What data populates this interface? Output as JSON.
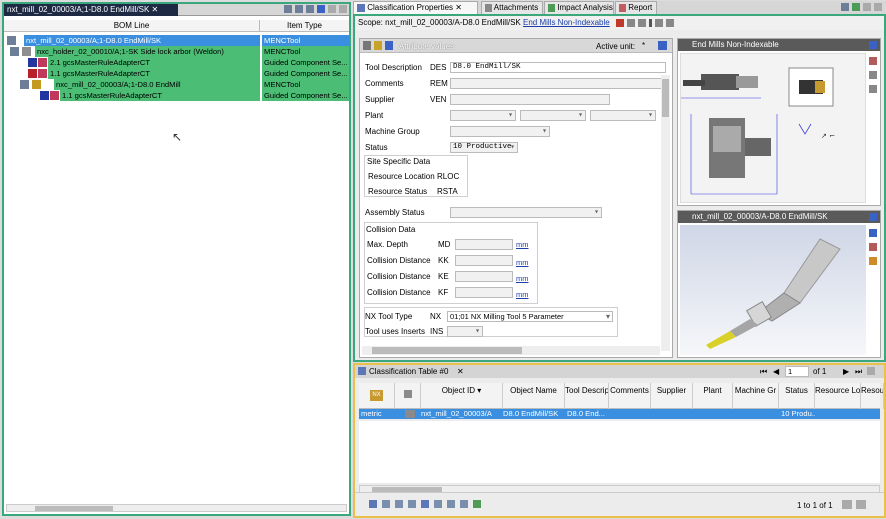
{
  "bom": {
    "tab_title": "nxt_mill_02_00003/A;1-D8.0 EndMill/SK",
    "col_bom_line": "BOM Line",
    "col_item_type": "Item Type",
    "rows": [
      {
        "label": "nxt_mill_02_00003/A;1-D8.0 EndMill/SK",
        "type": "MENCTool"
      },
      {
        "label": "nxc_holder_02_00010/A;1-SK Side lock arbor (Weldon)",
        "type": "MENCTool"
      },
      {
        "label": "2.1 gcsMasterRuleAdapterCT",
        "type": "Guided Component Se..."
      },
      {
        "label": "1.1 gcsMasterRuleAdapterCT",
        "type": "Guided Component Se..."
      },
      {
        "label": "nxc_mill_02_00003/A;1-D8.0 EndMill",
        "type": "MENCTool"
      },
      {
        "label": "1.1 gcsMasterRuleAdapterCT",
        "type": "Guided Component Se..."
      }
    ]
  },
  "right_tabs": {
    "classification": "Classification Properties",
    "attachments": "Attachments",
    "impact": "Impact Analysis",
    "report": "Report"
  },
  "scope": {
    "prefix": "Scope: nxt_mill_02_00003/A-D8.0 EndMill/SK",
    "link": "End Mills Non-Indexable"
  },
  "attr": {
    "header": "Attribute values",
    "active_unit_label": "Active unit:",
    "active_unit_value": "*",
    "tool_desc_label": "Tool Description",
    "tool_desc_code": "DES",
    "tool_desc_value": "D8.0 EndMill/SK",
    "comments_label": "Comments",
    "comments_code": "REM",
    "supplier_label": "Supplier",
    "supplier_code": "VEN",
    "plant_label": "Plant",
    "machine_group_label": "Machine Group",
    "status_label": "Status",
    "status_value": "10 Productive",
    "site_specific": "Site Specific Data",
    "res_loc_label": "Resource Location",
    "res_loc_code": "RLOC",
    "res_status_label": "Resource Status",
    "res_status_code": "RSTA",
    "assembly_status_label": "Assembly Status",
    "collision_data": "Collision Data",
    "max_depth_label": "Max. Depth",
    "max_depth_code": "MD",
    "cd_kk_label": "Collision Distance",
    "cd_kk_code": "KK",
    "cd_ke_label": "Collision Distance",
    "cd_ke_code": "KE",
    "cd_kf_label": "Collision Distance",
    "cd_kf_code": "KF",
    "mm": "mm",
    "nx_tool_type_label": "NX Tool Type",
    "nx_tool_type_code": "NX",
    "nx_tool_type_value": "01;01 NX Milling Tool 5 Parameter",
    "inserts_label": "Tool uses Inserts",
    "inserts_code": "INS"
  },
  "panel_top": {
    "title": "End Mills Non-Indexable"
  },
  "panel_bottom": {
    "title": "nxt_mill_02_00003/A-D8.0 EndMill/SK"
  },
  "ctable": {
    "title": "Classification Table #0",
    "page_value": "1",
    "page_of": "of 1",
    "nx_icon": "NX",
    "columns": [
      "Object ID",
      "Object Name",
      "Tool Description",
      "Comments",
      "Supplier",
      "Plant",
      "Machine Gr",
      "Status",
      "Resource Lo",
      "Resou"
    ],
    "row": [
      "metric",
      "nxt_mill_02_00003/A",
      "D8.0 EndMill/SK",
      "D8.0 End...",
      "",
      "",
      "",
      "",
      "10 Produ...",
      "",
      ""
    ],
    "footer_count": "1 to 1 of 1"
  },
  "colors": {
    "accent_green": "#3aa87c",
    "selection_blue": "#3a8fe0",
    "bom_green": "#4bbd74",
    "table_border": "#e8c04a"
  }
}
